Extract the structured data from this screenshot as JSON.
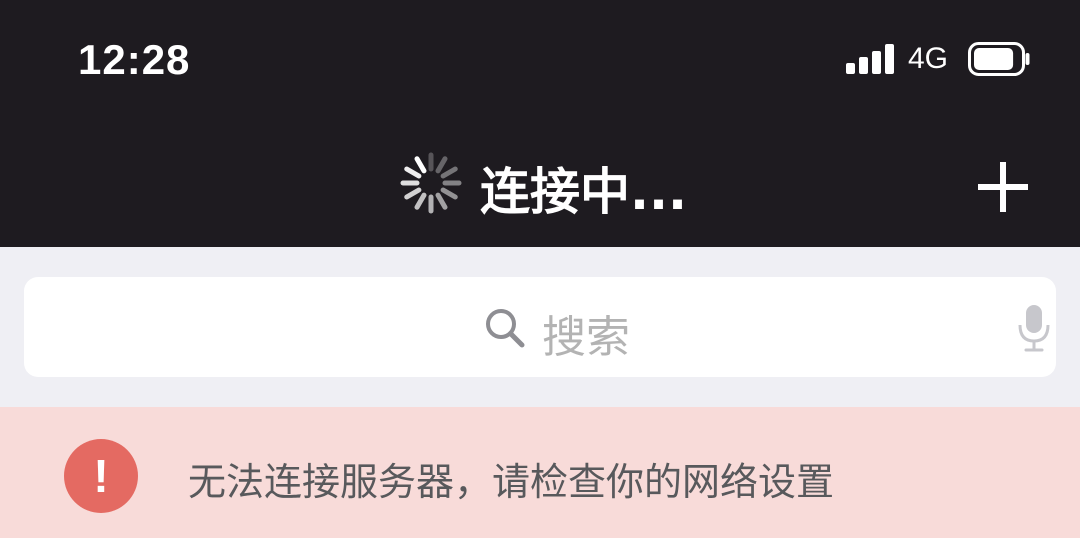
{
  "status_bar": {
    "time": "12:28",
    "network": "4G",
    "signal_bars": 4,
    "battery_level": 0.85,
    "text_color": "#ffffff",
    "background": "#1e1b20"
  },
  "nav_bar": {
    "title": "连接中...",
    "loading_icon": "spinner-icon",
    "action_icon": "plus-icon"
  },
  "search": {
    "placeholder": "搜索",
    "search_icon": "search-icon",
    "voice_icon": "microphone-icon"
  },
  "alert": {
    "icon_text": "!",
    "message": "无法连接服务器，请检查你的网络设置",
    "icon_color": "#e46a62",
    "background": "#f8dbd9"
  }
}
